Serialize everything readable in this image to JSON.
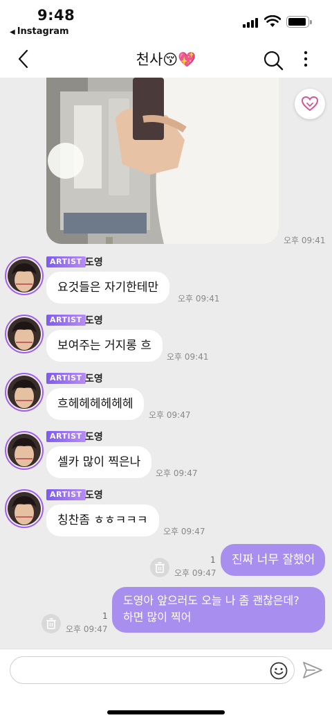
{
  "status_bar": {
    "time": "9:48",
    "back_app_label": "Instagram"
  },
  "header": {
    "title": "천사😚💖"
  },
  "photo_message": {
    "time": "오후 09:41"
  },
  "incoming": [
    {
      "badge": "ARTIST",
      "sender": "도영",
      "text": "요것들은 자기한테만",
      "time": "오후 09:41"
    },
    {
      "badge": "ARTIST",
      "sender": "도영",
      "text": "보여주는 거지롱 흐",
      "time": "오후 09:41"
    },
    {
      "badge": "ARTIST",
      "sender": "도영",
      "text": "흐헤헤헤헤헤헤",
      "time": "오후 09:47"
    },
    {
      "badge": "ARTIST",
      "sender": "도영",
      "text": "셀카 많이 찍은나",
      "time": "오후 09:47"
    },
    {
      "badge": "ARTIST",
      "sender": "도영",
      "text": "칭찬좀 ㅎㅎㅋㅋㅋ",
      "time": "오후 09:47"
    }
  ],
  "outgoing": [
    {
      "text_lines": [
        "진짜 너무 잘했어"
      ],
      "read_count": "1",
      "time": "오후 09:47"
    },
    {
      "text_lines": [
        "도영아 앞으러도 오늘 나 좀 괜찮은데?",
        "하면 많이 찍어"
      ],
      "read_count": "1",
      "time": "오후 09:47"
    }
  ],
  "input": {
    "placeholder": ""
  },
  "colors": {
    "accent_purple": "#a88fef",
    "artist_badge": "#7f5af0",
    "chat_background": "#ececec"
  },
  "icons": [
    "back-chevron-icon",
    "search-icon",
    "more-vertical-icon",
    "heart-icon",
    "trash-icon",
    "emoji-icon",
    "send-icon",
    "signal-icon",
    "wifi-icon",
    "battery-icon"
  ]
}
